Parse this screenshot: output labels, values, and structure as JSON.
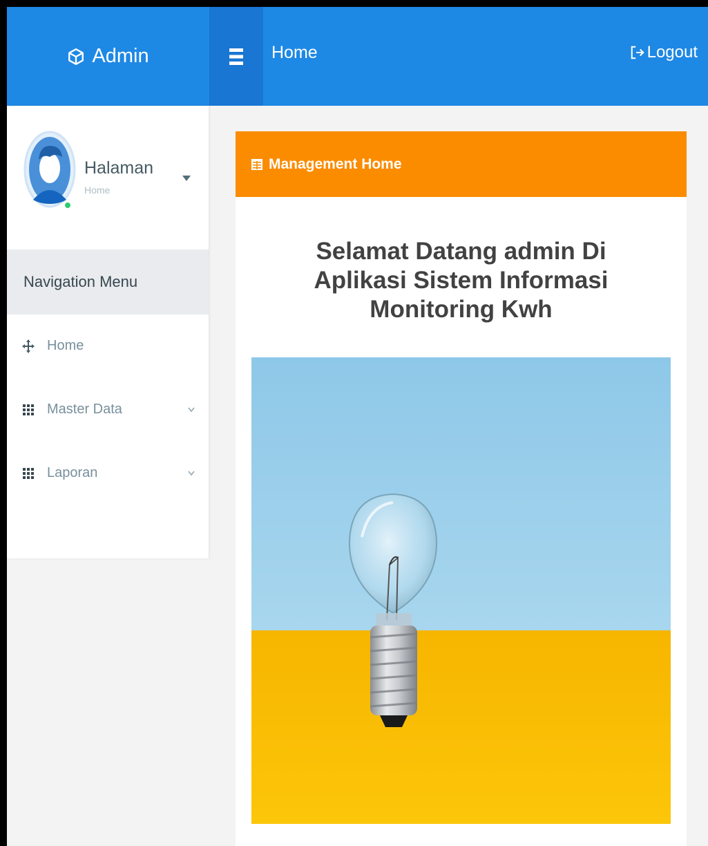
{
  "topbar": {
    "brand_label": "Admin",
    "page_title": "Home",
    "logout_label": "Logout",
    "color": "#1e88e5"
  },
  "sidebar": {
    "profile": {
      "name": "Halaman",
      "role": "Home",
      "status": "online"
    },
    "nav_header": "Navigation Menu",
    "items": [
      {
        "label": "Home",
        "icon": "arrows-move-icon",
        "has_submenu": false
      },
      {
        "label": "Master Data",
        "icon": "grid-icon",
        "has_submenu": true
      },
      {
        "label": "Laporan",
        "icon": "grid-icon",
        "has_submenu": true
      }
    ]
  },
  "card": {
    "header_label": "Management Home",
    "header_color": "#fb8c00",
    "welcome_text": "Selamat Datang admin Di Aplikasi Sistem Informasi Monitoring Kwh",
    "hero_image": "light-bulb-illustration"
  }
}
